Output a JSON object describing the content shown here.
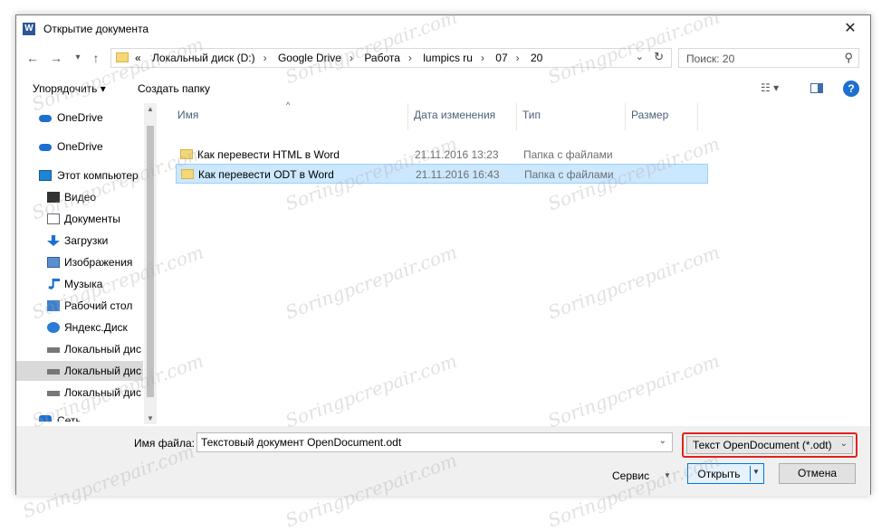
{
  "window": {
    "title": "Открытие документа",
    "app_icon_letter": "W",
    "close_glyph": "✕"
  },
  "nav": {
    "back_glyph": "←",
    "forward_glyph": "→",
    "recent_glyph": "▾",
    "up_glyph": "↑",
    "breadcrumb_prefix": "«",
    "breadcrumbs": [
      "Локальный диск (D:)",
      "Google Drive",
      "Работа",
      "lumpics ru",
      "07",
      "20"
    ],
    "breadcrumb_separator": "›",
    "address_dropdown_glyph": "⌄",
    "refresh_glyph": "↻"
  },
  "search": {
    "placeholder": "Поиск: 20",
    "icon_glyph": "⚲"
  },
  "toolbar": {
    "organize_label": "Упорядочить ▾",
    "new_folder_label": "Создать папку",
    "views_glyph": "☷ ▾",
    "help_glyph": "?"
  },
  "sidebar": {
    "items": [
      {
        "label": "OneDrive",
        "icon": "onedrive-icon"
      },
      {
        "label": "OneDrive",
        "icon": "onedrive-icon"
      },
      {
        "label": "Этот компьютер",
        "icon": "computer-icon"
      },
      {
        "label": "Видео",
        "icon": "video-icon"
      },
      {
        "label": "Документы",
        "icon": "documents-icon"
      },
      {
        "label": "Загрузки",
        "icon": "downloads-icon"
      },
      {
        "label": "Изображения",
        "icon": "pictures-icon"
      },
      {
        "label": "Музыка",
        "icon": "music-icon"
      },
      {
        "label": "Рабочий стол",
        "icon": "desktop-icon"
      },
      {
        "label": "Яндекс.Диск",
        "icon": "yandex-disk-icon"
      },
      {
        "label": "Локальный дис",
        "icon": "drive-icon"
      },
      {
        "label": "Локальный дис",
        "icon": "drive-icon",
        "selected": true
      },
      {
        "label": "Локальный дис",
        "icon": "drive-icon"
      },
      {
        "label": "Сеть",
        "icon": "network-icon"
      }
    ],
    "scroll_up_glyph": "▲",
    "scroll_down_glyph": "▼"
  },
  "file_list": {
    "columns": [
      "Имя",
      "Дата изменения",
      "Тип",
      "Размер"
    ],
    "sort_glyph": "^",
    "rows": [
      {
        "name": "Как перевести HTML в Word",
        "date": "21.11.2016 13:23",
        "type": "Папка с файлами",
        "size": ""
      },
      {
        "name": "Как перевести ODT в Word",
        "date": "21.11.2016 16:43",
        "type": "Папка с файлами",
        "size": "",
        "selected": true
      }
    ]
  },
  "bottom": {
    "filename_label": "Имя файла:",
    "filename_value": "Текстовый документ OpenDocument.odt",
    "filename_chevron": "⌄",
    "filter_value": "Текст OpenDocument (*.odt)",
    "filter_chevron": "⌄",
    "filter_highlight_color": "#e0231c",
    "tools_label": "Сервис",
    "tools_chevron": "▼",
    "open_label": "Открыть",
    "open_chevron": "▼",
    "cancel_label": "Отмена"
  },
  "watermark": "Soringpcrepair.com",
  "colors": {
    "selection_bg": "#cce8ff",
    "accent": "#0078d7"
  }
}
